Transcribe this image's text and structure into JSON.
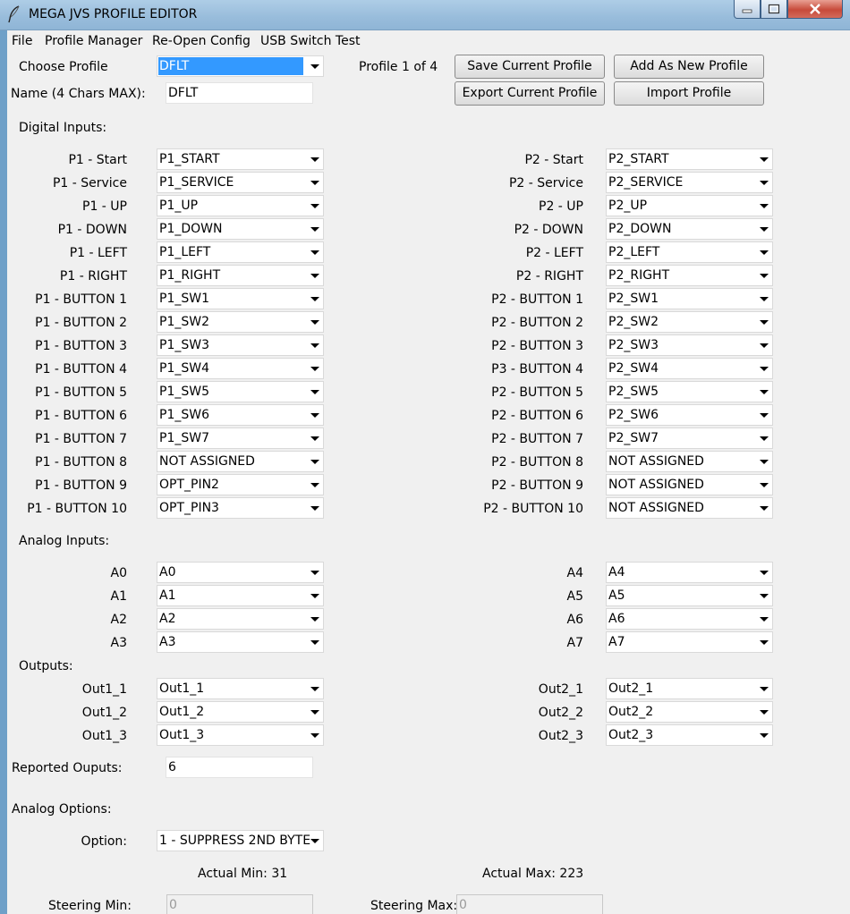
{
  "window": {
    "title": "MEGA JVS PROFILE EDITOR"
  },
  "menu": [
    "File",
    "Profile Manager",
    "Re-Open Config",
    "USB Switch Test"
  ],
  "profile": {
    "choose_label": "Choose Profile",
    "selected": "DFLT",
    "counter": "Profile 1 of 4",
    "name_label": "Name (4 Chars MAX):",
    "name_value": "DFLT"
  },
  "buttons": {
    "save": "Save Current Profile",
    "add": "Add As New Profile",
    "export": "Export Current Profile",
    "import": "Import Profile"
  },
  "digital": {
    "header": "Digital Inputs:",
    "p1": [
      {
        "label": "P1 - Start",
        "value": "P1_START"
      },
      {
        "label": "P1 - Service",
        "value": "P1_SERVICE"
      },
      {
        "label": "P1 - UP",
        "value": "P1_UP"
      },
      {
        "label": "P1 - DOWN",
        "value": "P1_DOWN"
      },
      {
        "label": "P1 - LEFT",
        "value": "P1_LEFT"
      },
      {
        "label": "P1 - RIGHT",
        "value": "P1_RIGHT"
      },
      {
        "label": "P1 - BUTTON 1",
        "value": "P1_SW1"
      },
      {
        "label": "P1 - BUTTON 2",
        "value": "P1_SW2"
      },
      {
        "label": "P1 - BUTTON 3",
        "value": "P1_SW3"
      },
      {
        "label": "P1 - BUTTON 4",
        "value": "P1_SW4"
      },
      {
        "label": "P1 - BUTTON 5",
        "value": "P1_SW5"
      },
      {
        "label": "P1 - BUTTON 6",
        "value": "P1_SW6"
      },
      {
        "label": "P1 - BUTTON 7",
        "value": "P1_SW7"
      },
      {
        "label": "P1 - BUTTON 8",
        "value": "NOT ASSIGNED"
      },
      {
        "label": "P1 - BUTTON 9",
        "value": "OPT_PIN2"
      },
      {
        "label": "P1 - BUTTON 10",
        "value": "OPT_PIN3"
      }
    ],
    "p2": [
      {
        "label": "P2 - Start",
        "value": "P2_START"
      },
      {
        "label": "P2 - Service",
        "value": "P2_SERVICE"
      },
      {
        "label": "P2 - UP",
        "value": "P2_UP"
      },
      {
        "label": "P2 - DOWN",
        "value": "P2_DOWN"
      },
      {
        "label": "P2 - LEFT",
        "value": "P2_LEFT"
      },
      {
        "label": "P2 - RIGHT",
        "value": "P2_RIGHT"
      },
      {
        "label": "P2 - BUTTON 1",
        "value": "P2_SW1"
      },
      {
        "label": "P2 - BUTTON 2",
        "value": "P2_SW2"
      },
      {
        "label": "P2 - BUTTON 3",
        "value": "P2_SW3"
      },
      {
        "label": "P3 - BUTTON 4",
        "value": "P2_SW4"
      },
      {
        "label": "P2 - BUTTON 5",
        "value": "P2_SW5"
      },
      {
        "label": "P2 - BUTTON 6",
        "value": "P2_SW6"
      },
      {
        "label": "P2 - BUTTON 7",
        "value": "P2_SW7"
      },
      {
        "label": "P2 - BUTTON 8",
        "value": "NOT ASSIGNED"
      },
      {
        "label": "P2 - BUTTON 9",
        "value": "NOT ASSIGNED"
      },
      {
        "label": "P2 - BUTTON 10",
        "value": "NOT ASSIGNED"
      }
    ]
  },
  "analog": {
    "header": "Analog Inputs:",
    "left": [
      {
        "label": "A0",
        "value": "A0"
      },
      {
        "label": "A1",
        "value": "A1"
      },
      {
        "label": "A2",
        "value": "A2"
      },
      {
        "label": "A3",
        "value": "A3"
      }
    ],
    "right": [
      {
        "label": "A4",
        "value": "A4"
      },
      {
        "label": "A5",
        "value": "A5"
      },
      {
        "label": "A6",
        "value": "A6"
      },
      {
        "label": "A7",
        "value": "A7"
      }
    ]
  },
  "outputs": {
    "header": "Outputs:",
    "left": [
      {
        "label": "Out1_1",
        "value": "Out1_1"
      },
      {
        "label": "Out1_2",
        "value": "Out1_2"
      },
      {
        "label": "Out1_3",
        "value": "Out1_3"
      }
    ],
    "right": [
      {
        "label": "Out2_1",
        "value": "Out2_1"
      },
      {
        "label": "Out2_2",
        "value": "Out2_2"
      },
      {
        "label": "Out2_3",
        "value": "Out2_3"
      }
    ],
    "reported_label": "Reported Ouputs:",
    "reported_value": "6"
  },
  "analog_options": {
    "header": "Analog Options:",
    "option_label": "Option:",
    "option_value": "1 - SUPPRESS 2ND BYTE",
    "actual_min": "Actual Min: 31",
    "actual_max": "Actual Max: 223",
    "steering_min_label": "Steering Min:",
    "steering_min_value": "0",
    "steering_max_label": "Steering Max:",
    "steering_max_value": "0"
  }
}
